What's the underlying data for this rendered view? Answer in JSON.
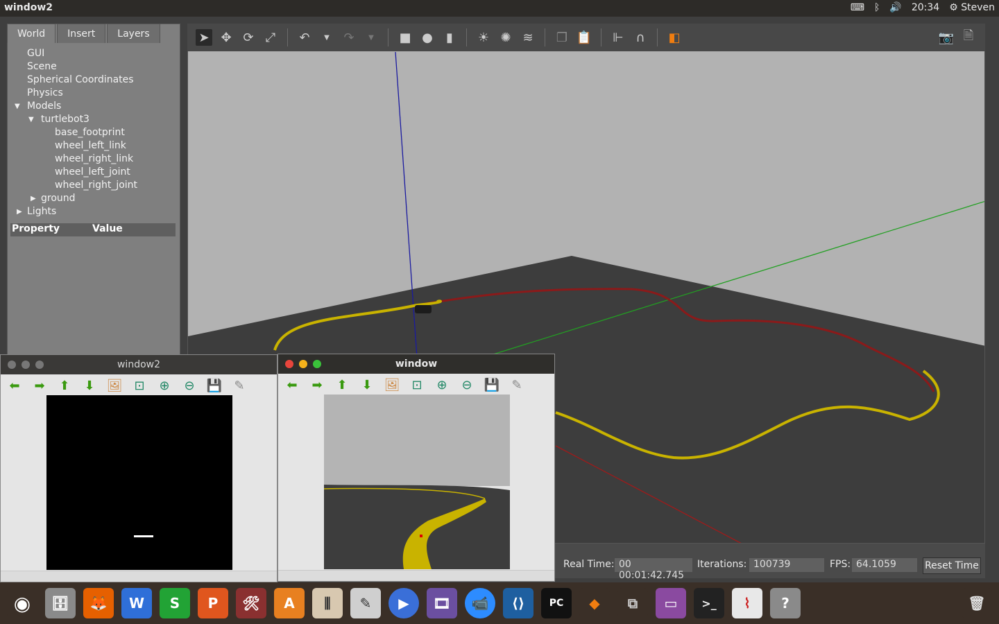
{
  "topbar": {
    "title": "window2",
    "time": "20:34",
    "user": "Steven"
  },
  "gazebo": {
    "tabs": [
      "World",
      "Insert",
      "Layers"
    ],
    "tree": {
      "gui": "GUI",
      "scene": "Scene",
      "spherical": "Spherical Coordinates",
      "physics": "Physics",
      "models": "Models",
      "turtlebot": "turtlebot3",
      "base_footprint": "base_footprint",
      "wheel_left_link": "wheel_left_link",
      "wheel_right_link": "wheel_right_link",
      "wheel_left_joint": "wheel_left_joint",
      "wheel_right_joint": "wheel_right_joint",
      "ground": "ground",
      "lights": "Lights"
    },
    "property_header": {
      "property": "Property",
      "value": "Value"
    },
    "status": {
      "real_time_label": "Real Time:",
      "real_time": "00 00:01:42.745",
      "iterations_label": "Iterations:",
      "iterations": "100739",
      "fps_label": "FPS:",
      "fps": "64.1059",
      "reset": "Reset Time"
    }
  },
  "cv_windows": {
    "w2_title": "window2",
    "w1_title": "window"
  },
  "colors": {
    "panel": "#7f7f7f",
    "sky": "#b2b2b2",
    "ground": "#3d3d3d",
    "track": "#c9b300",
    "trail": "#8b1a1a"
  }
}
